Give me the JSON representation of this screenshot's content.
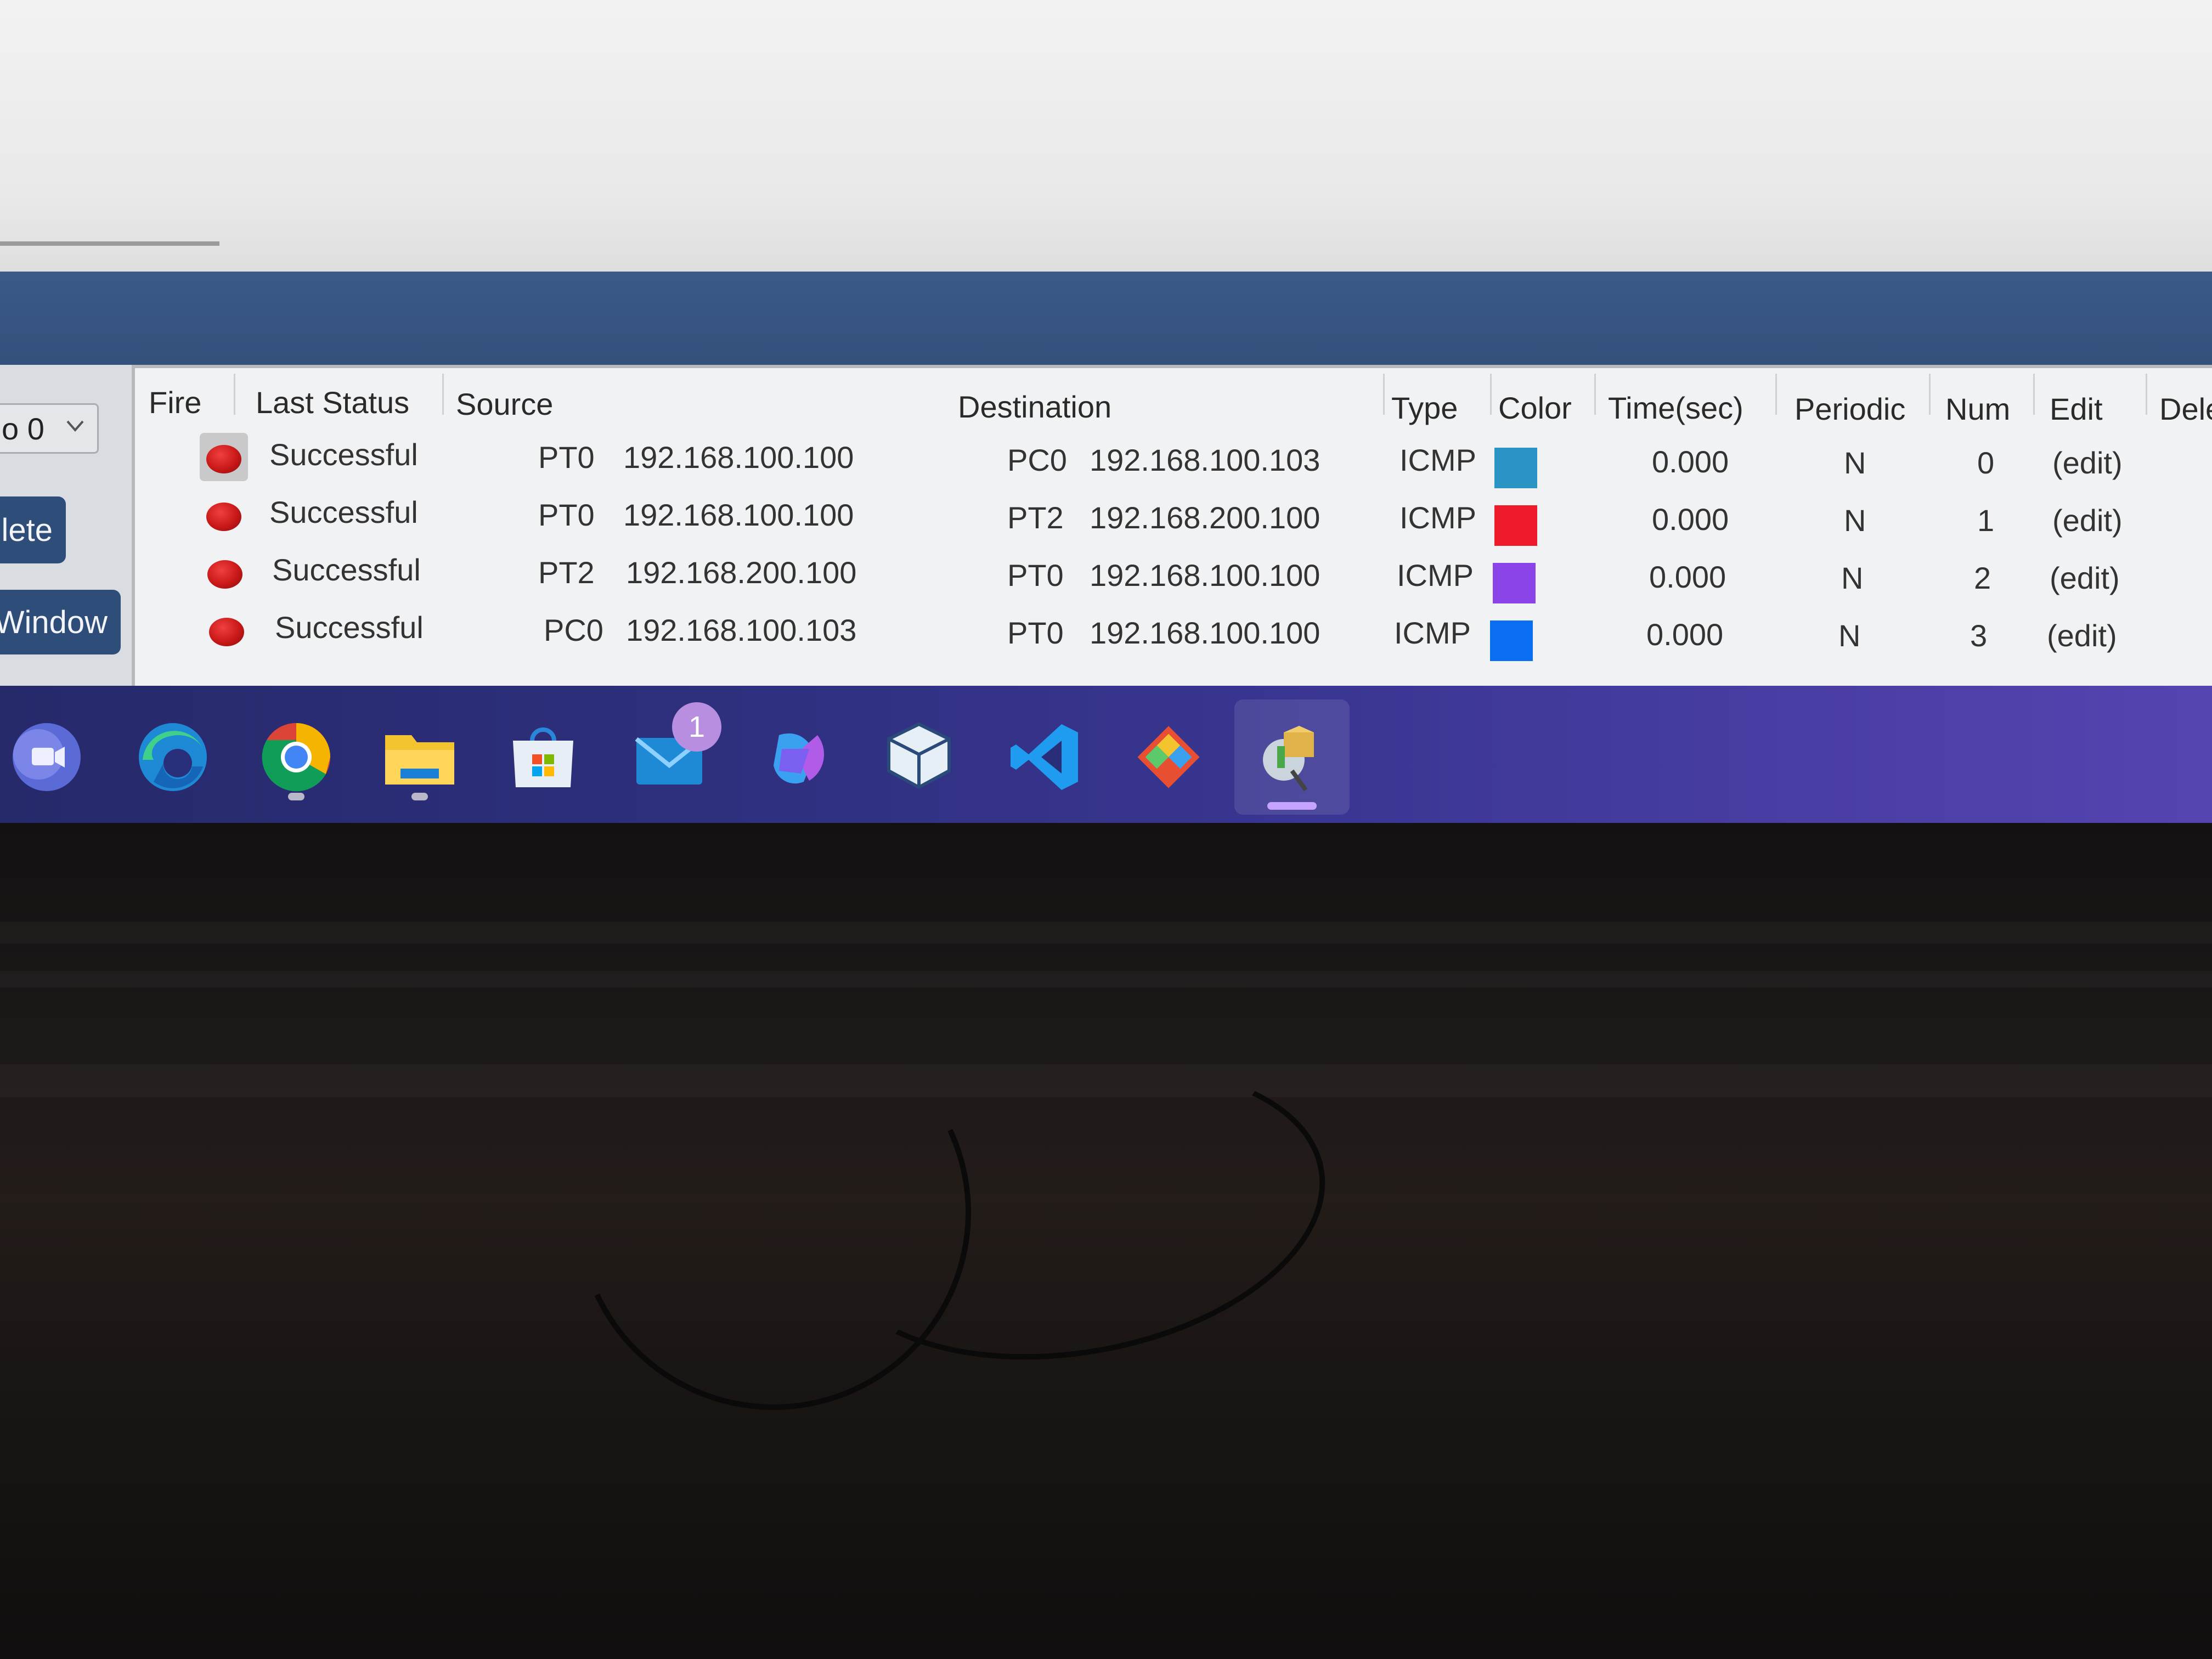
{
  "controls": {
    "scenario_select_value": "o 0",
    "delete_label": "lete",
    "window_label": "Window"
  },
  "pdu_table": {
    "headers": {
      "fire": "Fire",
      "last_status": "Last Status",
      "source": "Source",
      "destination": "Destination",
      "type": "Type",
      "color": "Color",
      "time": "Time(sec)",
      "periodic": "Periodic",
      "num": "Num",
      "edit": "Edit",
      "delete": "Dele"
    },
    "rows": [
      {
        "status": "Successful",
        "source_device": "PT0",
        "source_ip": "192.168.100.100",
        "dest_device": "PC0",
        "dest_ip": "192.168.100.103",
        "type": "ICMP",
        "color": "#2a95c4",
        "time": "0.000",
        "periodic": "N",
        "num": "0",
        "edit": "(edit)"
      },
      {
        "status": "Successful",
        "source_device": "PT0",
        "source_ip": "192.168.100.100",
        "dest_device": "PT2",
        "dest_ip": "192.168.200.100",
        "type": "ICMP",
        "color": "#ee1c2a",
        "time": "0.000",
        "periodic": "N",
        "num": "1",
        "edit": "(edit)"
      },
      {
        "status": "Successful",
        "source_device": "PT2",
        "source_ip": "192.168.200.100",
        "dest_device": "PT0",
        "dest_ip": "192.168.100.100",
        "type": "ICMP",
        "color": "#8a44e8",
        "time": "0.000",
        "periodic": "N",
        "num": "2",
        "edit": "(edit)"
      },
      {
        "status": "Successful",
        "source_device": "PC0",
        "source_ip": "192.168.100.103",
        "dest_device": "PT0",
        "dest_ip": "192.168.100.100",
        "type": "ICMP",
        "color": "#0a6ef0",
        "time": "0.000",
        "periodic": "N",
        "num": "3",
        "edit": "(edit)"
      }
    ]
  },
  "taskbar": {
    "icons": [
      "meet-icon",
      "edge-icon",
      "chrome-icon",
      "file-explorer-icon",
      "store-icon",
      "mail-icon",
      "copilot-icon",
      "virtualbox-icon",
      "vscode-icon",
      "git-icon",
      "packet-tracer-icon"
    ],
    "mail_badge": "1"
  }
}
